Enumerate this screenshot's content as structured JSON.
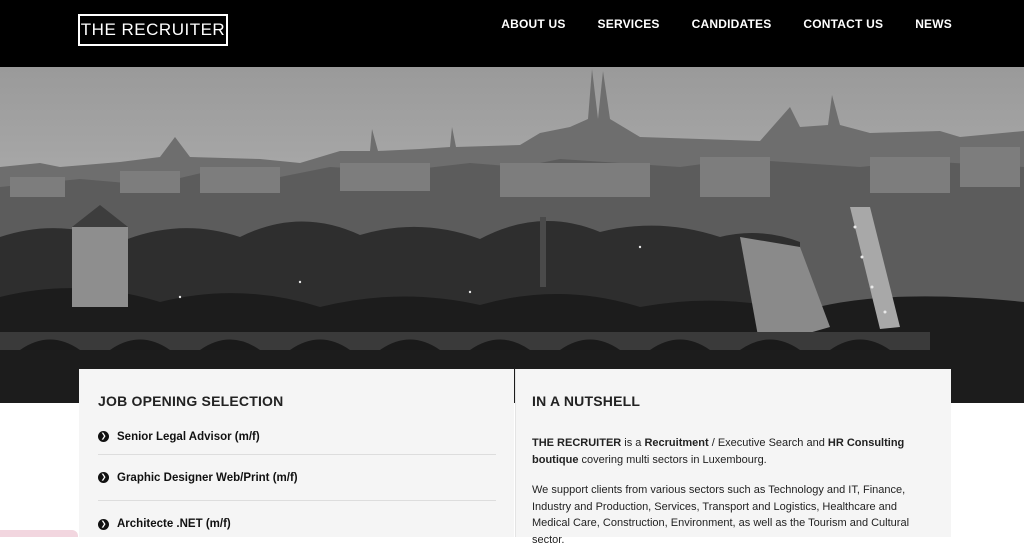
{
  "header": {
    "logo": "THE RECRUITER",
    "nav": [
      "ABOUT US",
      "SERVICES",
      "CANDIDATES",
      "CONTACT US",
      "NEWS"
    ]
  },
  "jobs": {
    "title": "JOB OPENING SELECTION",
    "items": [
      "Senior Legal Advisor (m/f)",
      "Graphic Designer Web/Print (m/f)",
      "Architecte .NET (m/f)"
    ]
  },
  "nutshell": {
    "title": "IN A NUTSHELL",
    "p1_brand": "THE RECRUITER",
    "p1_a": " is a ",
    "p1_b1": "Recruitment",
    "p1_c": " / Executive Search and ",
    "p1_b2": "HR Consulting boutique",
    "p1_d": " covering multi sectors in Luxembourg.",
    "p2": "We support clients from various sectors such as Technology and IT, Finance, Industry and Production, Services, Transport and Logistics, Healthcare and Medical Care, Construction, Environment, as well as the Tourism and Cultural sector."
  },
  "colors": {
    "header_bg": "#000000",
    "panel_bg": "#f5f5f5",
    "text": "#222222"
  }
}
